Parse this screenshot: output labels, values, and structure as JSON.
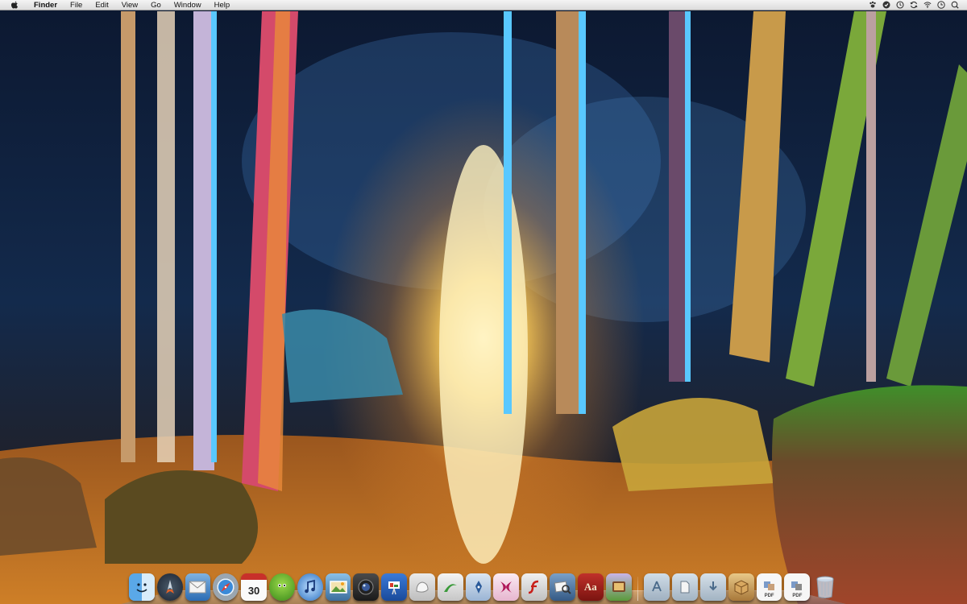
{
  "menubar": {
    "app_name": "Finder",
    "items": [
      {
        "label": "File"
      },
      {
        "label": "Edit"
      },
      {
        "label": "View"
      },
      {
        "label": "Go"
      },
      {
        "label": "Window"
      },
      {
        "label": "Help"
      }
    ],
    "extras": [
      "paw-icon",
      "check-circle-icon",
      "time-machine-icon",
      "sync-icon",
      "wifi-icon",
      "clock-icon",
      "spotlight-search-icon"
    ]
  },
  "dock": {
    "apps": [
      {
        "name": "finder-icon"
      },
      {
        "name": "launchpad-icon"
      },
      {
        "name": "mail-icon"
      },
      {
        "name": "safari-icon"
      },
      {
        "name": "ical-icon",
        "text": "30"
      },
      {
        "name": "adium-icon"
      },
      {
        "name": "itunes-icon"
      },
      {
        "name": "iphoto-icon"
      },
      {
        "name": "aperture-icon"
      },
      {
        "name": "keynote-icon"
      },
      {
        "name": "photoshop-icon"
      },
      {
        "name": "dreamweaver-icon"
      },
      {
        "name": "illustrator-icon"
      },
      {
        "name": "flash-icon"
      },
      {
        "name": "flash-player-icon"
      },
      {
        "name": "preview-icon"
      },
      {
        "name": "dictionary-icon",
        "text": "Aa"
      },
      {
        "name": "mac-app-store-icon"
      }
    ],
    "docs": [
      {
        "name": "applications-folder-icon"
      },
      {
        "name": "documents-folder-icon"
      },
      {
        "name": "downloads-folder-icon"
      },
      {
        "name": "package-icon"
      },
      {
        "name": "pdf-document-icon",
        "text": "PDF"
      },
      {
        "name": "pdf-document-icon-2",
        "text": "PDF"
      },
      {
        "name": "trash-icon"
      }
    ]
  },
  "colors": {
    "menubar_bg": "#e8e8e8",
    "light_glow": "#ffd36b",
    "tree_blue": "#59c8ff",
    "moss_green": "#48a02c",
    "leaf_orange": "#d9822b"
  }
}
